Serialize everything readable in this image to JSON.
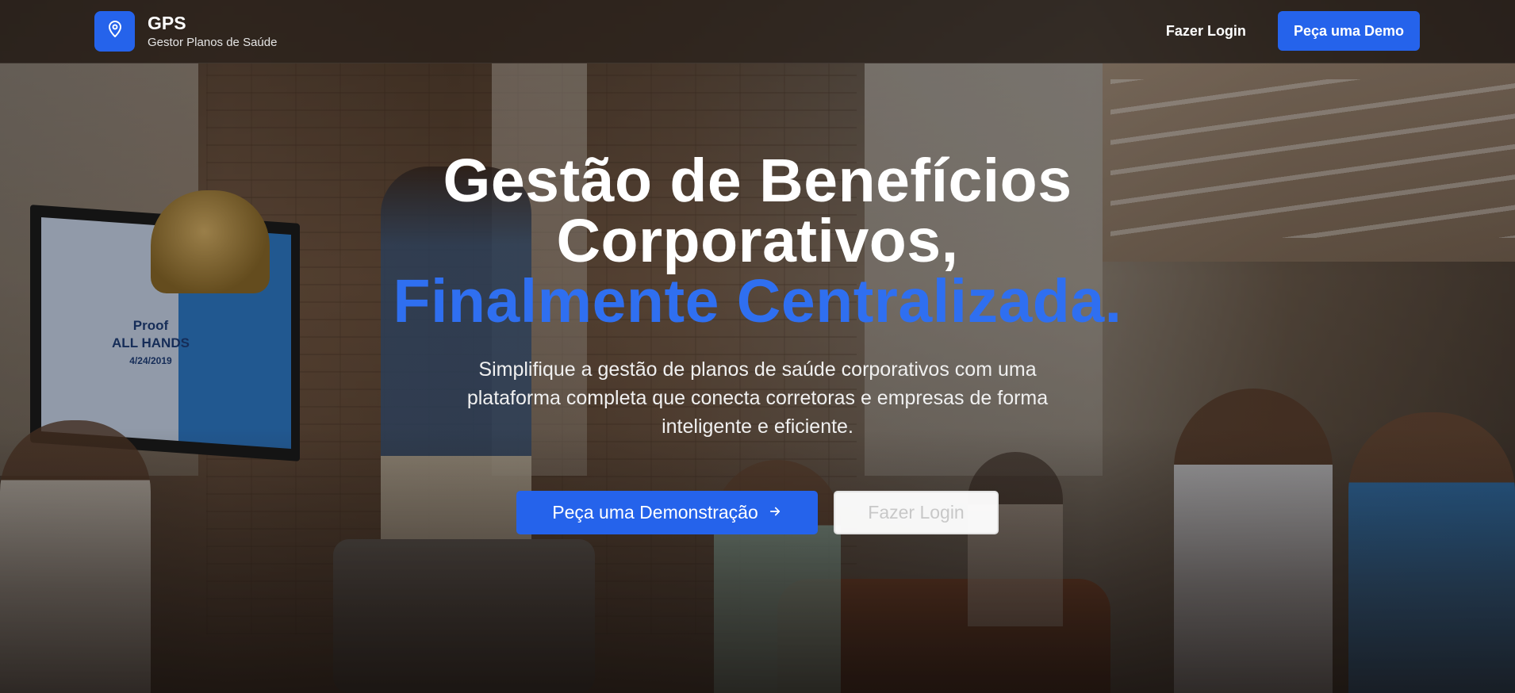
{
  "brand": {
    "title": "GPS",
    "subtitle": "Gestor Planos de Saúde",
    "icon": "map-pin-icon",
    "color": "#2563eb"
  },
  "nav": {
    "login_label": "Fazer Login",
    "demo_label": "Peça uma Demo"
  },
  "hero": {
    "title_line1": "Gestão de Benefícios",
    "title_line2": "Corporativos,",
    "title_accent": "Finalmente Centralizada.",
    "description": "Simplifique a gestão de planos de saúde corporativos com uma plataforma completa que conecta corretoras e empresas de forma inteligente e eficiente.",
    "primary_cta": "Peça uma Demonstração",
    "primary_cta_icon": "arrow-right-icon",
    "secondary_cta": "Fazer Login",
    "accent_color": "#2f6ff0"
  },
  "background_photo": {
    "tv_line1": "Proof",
    "tv_line2": "ALL HANDS",
    "tv_date": "4/24/2019"
  }
}
